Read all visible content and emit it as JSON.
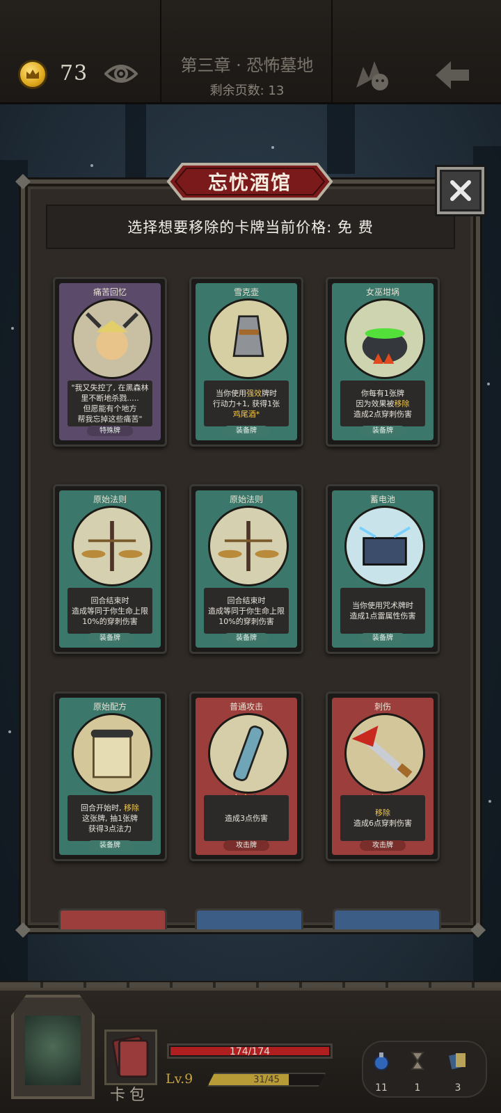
{
  "header": {
    "gold": "73",
    "chapter": "第三章 · 恐怖墓地",
    "pages_remaining": "剩余页数: 13",
    "icons": [
      "crown-coin-icon",
      "eye-icon",
      "pet-icon",
      "back-arrow-icon"
    ]
  },
  "modal": {
    "title": "忘忧酒馆",
    "subtitle": "选择想要移除的卡牌当前价格: 免 费",
    "close_icon": "close-icon"
  },
  "cards": [
    {
      "name": "痛苦回忆",
      "frame": "purple",
      "lines": [
        "\"我又失控了, 在黑森林",
        "里不断地杀戮.....",
        "但愿能有个地方",
        "帮我忘掉这些痛苦\""
      ],
      "type": "特殊牌"
    },
    {
      "name": "雪克壶",
      "frame": "teal",
      "lines": [
        "当你使用强效牌时",
        "行动力+1, 获得1张",
        "鸡尾酒*"
      ],
      "type": "装备牌"
    },
    {
      "name": "女巫坩埚",
      "frame": "teal",
      "lines": [
        "你每有1张牌",
        "因为效果被移除",
        "造成2点穿刺伤害"
      ],
      "type": "装备牌"
    },
    {
      "name": "原始法则",
      "frame": "teal",
      "lines": [
        "回合结束时",
        "造成等同于你生命上限",
        "10%的穿刺伤害"
      ],
      "type": "装备牌"
    },
    {
      "name": "原始法则",
      "frame": "teal",
      "lines": [
        "回合结束时",
        "造成等同于你生命上限",
        "10%的穿刺伤害"
      ],
      "type": "装备牌"
    },
    {
      "name": "蓄电池",
      "frame": "teal",
      "lines": [
        "当你使用咒术牌时",
        "造成1点雷属性伤害"
      ],
      "type": "装备牌"
    },
    {
      "name": "原始配方",
      "frame": "teal",
      "lines": [
        "回合开始时, 移除",
        "这张牌, 抽1张牌",
        "获得3点法力"
      ],
      "type": "装备牌"
    },
    {
      "name": "普通攻击",
      "frame": "red",
      "stars": 2,
      "lines": [
        "造成3点伤害"
      ],
      "type": "攻击牌"
    },
    {
      "name": "刺伤",
      "frame": "red",
      "stars": 1,
      "lines": [
        "移除",
        "造成6点穿刺伤害"
      ],
      "type": "攻击牌"
    }
  ],
  "highlights": [
    "强效",
    "鸡尾酒*",
    "移除"
  ],
  "bottom": {
    "hp": "174/174",
    "hp_ratio": 1.0,
    "level": "Lv.9",
    "xp": "31/45",
    "xp_ratio": 0.69,
    "deck_label": "卡包",
    "potions": "11",
    "hourglass": "1",
    "cards": "3"
  },
  "colors": {
    "purple": "#5b4a69",
    "teal": "#3b776a",
    "red": "#9c3f3c",
    "blue": "#3b5d86",
    "highlight": "#f0c64c",
    "title_banner": "#7a1a1a"
  }
}
